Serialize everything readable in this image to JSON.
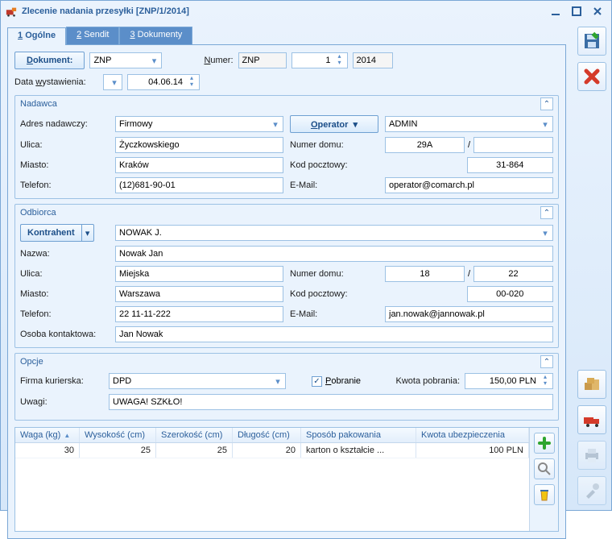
{
  "window": {
    "title": "Zlecenie nadania przesyłki [ZNP/1/2014]"
  },
  "tabs": {
    "t1_num": "1",
    "t1": "Ogólne",
    "t2_num": "2",
    "t2": "Sendit",
    "t3_num": "3",
    "t3": "Dokumenty"
  },
  "doc": {
    "dokument_btn": "Dokument:",
    "dok_type": "ZNP",
    "numer_lbl": "Numer:",
    "numer_prefix": "ZNP",
    "numer_val": "1",
    "numer_year": "2014",
    "date_lbl": "Data wystawienia:",
    "date_val": "04.06.14"
  },
  "nadawca": {
    "title": "Nadawca",
    "adres_lbl": "Adres nadawczy:",
    "adres_val": "Firmowy",
    "operator_btn": "Operator",
    "operator_val": "ADMIN",
    "ulica_lbl": "Ulica:",
    "ulica_val": "Życzkowskiego",
    "numdom_lbl": "Numer domu:",
    "numdom_a": "29A",
    "numdom_sep": "/",
    "numdom_b": "",
    "miasto_lbl": "Miasto:",
    "miasto_val": "Kraków",
    "kod_lbl": "Kod pocztowy:",
    "kod_val": "31-864",
    "tel_lbl": "Telefon:",
    "tel_val": "(12)681-90-01",
    "email_lbl": "E-Mail:",
    "email_val": "operator@comarch.pl"
  },
  "odbiorca": {
    "title": "Odbiorca",
    "kontrahent_btn": "Kontrahent",
    "kontrahent_val": "NOWAK J.",
    "nazwa_lbl": "Nazwa:",
    "nazwa_val": "Nowak Jan",
    "ulica_lbl": "Ulica:",
    "ulica_val": "Miejska",
    "numdom_lbl": "Numer domu:",
    "numdom_a": "18",
    "numdom_sep": "/",
    "numdom_b": "22",
    "miasto_lbl": "Miasto:",
    "miasto_val": "Warszawa",
    "kod_lbl": "Kod pocztowy:",
    "kod_val": "00-020",
    "tel_lbl": "Telefon:",
    "tel_val": "22 11-11-222",
    "email_lbl": "E-Mail:",
    "email_val": "jan.nowak@jannowak.pl",
    "osoba_lbl": "Osoba kontaktowa:",
    "osoba_val": "Jan Nowak"
  },
  "opcje": {
    "title": "Opcje",
    "firma_lbl": "Firma kurierska:",
    "firma_val": "DPD",
    "pobranie_lbl": "Pobranie",
    "pobranie_checked": true,
    "kwota_lbl": "Kwota pobrania:",
    "kwota_val": "150,00 PLN",
    "uwagi_lbl": "Uwagi:",
    "uwagi_val": "UWAGA! SZKŁO!"
  },
  "table": {
    "cols": {
      "c1": "Waga (kg)",
      "c2": "Wysokość (cm)",
      "c3": "Szerokość (cm)",
      "c4": "Długość (cm)",
      "c5": "Sposób pakowania",
      "c6": "Kwota ubezpieczenia"
    },
    "row": {
      "c1": "30",
      "c2": "25",
      "c3": "25",
      "c4": "20",
      "c5": "karton o kształcie ...",
      "c6": "100 PLN"
    }
  },
  "icons": {
    "save": "save",
    "cancel": "cancel",
    "add": "add",
    "search": "search",
    "package": "package",
    "boxes": "boxes",
    "truck": "truck",
    "print": "print",
    "tools": "tools"
  }
}
